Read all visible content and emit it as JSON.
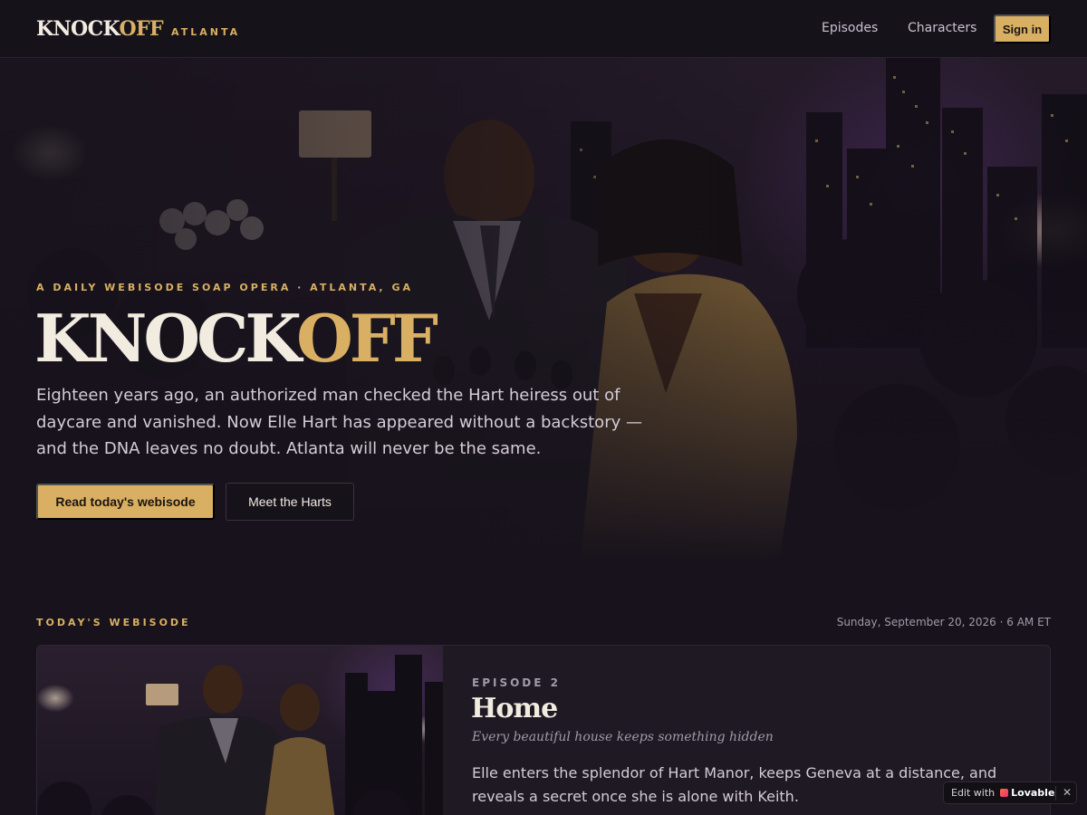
{
  "nav": {
    "logo_prefix": "KNOCK",
    "logo_highlight": "OFF",
    "logo_sub": "ATLANTA",
    "links": [
      "Episodes",
      "Characters"
    ],
    "signin": "Sign in"
  },
  "hero": {
    "eyebrow": "A DAILY WEBISODE SOAP OPERA · ATLANTA, GA",
    "title_prefix": "KNOCK",
    "title_highlight": "OFF",
    "description": "Eighteen years ago, an authorized man checked the Hart heiress out of daycare and vanished. Now Elle Hart has appeared without a backstory — and the DNA leaves no doubt. Atlanta will never be the same.",
    "primary_cta": "Read today's webisode",
    "secondary_cta": "Meet the Harts"
  },
  "today": {
    "label": "TODAY'S WEBISODE",
    "date": "Sunday, September 20, 2026 · 6 AM ET",
    "episode_label": "EPISODE 2",
    "title": "Home",
    "tagline": "Every beautiful house keeps something hidden",
    "summary": "Elle enters the splendor of Hart Manor, keeps Geneva at a distance, and reveals a secret once she is alone with Keith."
  },
  "badge": {
    "prefix": "Edit with",
    "brand": "Lovable",
    "close": "✕"
  },
  "colors": {
    "accent": "#d9b063",
    "background": "#17121b",
    "card": "#1f1924"
  }
}
